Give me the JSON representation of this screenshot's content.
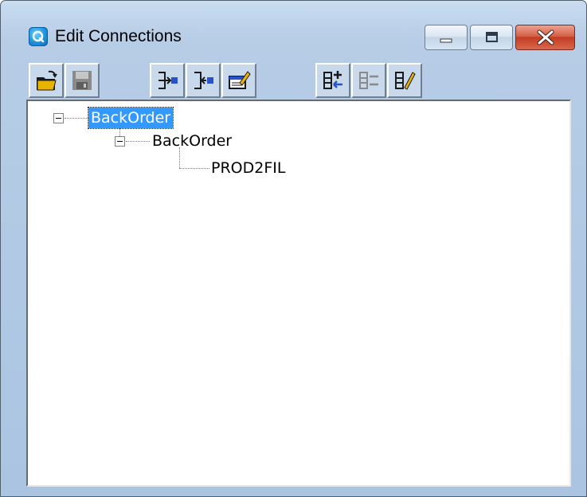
{
  "window": {
    "title": "Edit Connections",
    "app_icon": "qlik-q-icon"
  },
  "caption_buttons": [
    {
      "name": "minimize",
      "icon": "minimize-icon"
    },
    {
      "name": "maximize",
      "icon": "maximize-icon"
    },
    {
      "name": "close",
      "icon": "close-icon"
    }
  ],
  "toolbar": {
    "buttons": [
      {
        "icon": "open-folder-icon",
        "enabled": true
      },
      {
        "icon": "save-icon",
        "enabled": false
      },
      {
        "icon": "add-connection-icon",
        "enabled": true
      },
      {
        "icon": "remove-connection-icon",
        "enabled": true
      },
      {
        "icon": "edit-connection-icon",
        "enabled": true
      },
      {
        "icon": "add-table-icon",
        "enabled": true
      },
      {
        "icon": "remove-table-icon",
        "enabled": false
      },
      {
        "icon": "edit-table-icon",
        "enabled": true
      }
    ]
  },
  "tree": {
    "root": {
      "label": "BackOrder",
      "selected": true,
      "expanded": true
    },
    "child": {
      "label": "BackOrder",
      "expanded": true
    },
    "leaf": {
      "label": "PROD2FIL"
    }
  },
  "colors": {
    "selection": "#3399ff",
    "frame": "#b7cde6",
    "close_button": "#c33c22"
  }
}
